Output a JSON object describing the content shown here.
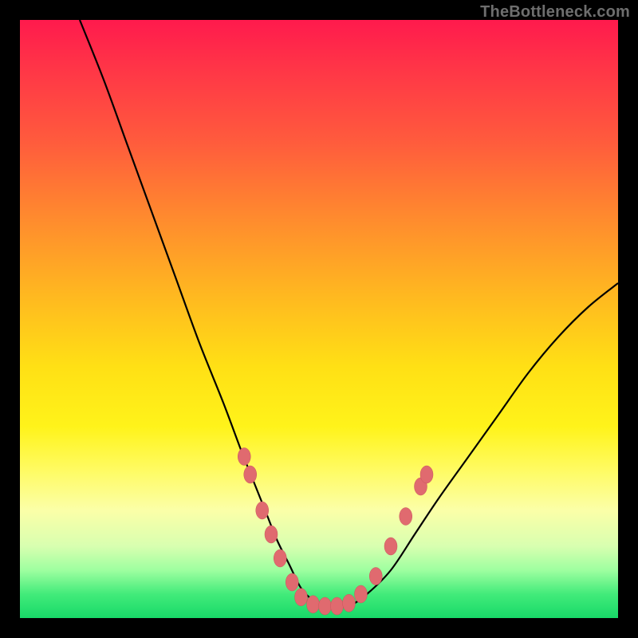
{
  "watermark": "TheBottleneck.com",
  "colors": {
    "curve_stroke": "#000000",
    "marker_fill": "#e06a6f",
    "marker_stroke": "#c9565c"
  },
  "chart_data": {
    "type": "line",
    "title": "",
    "xlabel": "",
    "ylabel": "",
    "xlim": [
      0,
      100
    ],
    "ylim": [
      0,
      100
    ],
    "series": [
      {
        "name": "bottleneck-curve",
        "x": [
          10,
          14,
          18,
          22,
          26,
          30,
          34,
          37,
          39,
          41,
          43,
          45,
          47,
          49,
          51,
          53,
          55,
          58,
          62,
          66,
          70,
          75,
          80,
          85,
          90,
          95,
          100
        ],
        "y": [
          100,
          90,
          79,
          68,
          57,
          46,
          36,
          28,
          23,
          18,
          13,
          9,
          5,
          3,
          2,
          2,
          2,
          4,
          8,
          14,
          20,
          27,
          34,
          41,
          47,
          52,
          56
        ]
      }
    ],
    "markers": {
      "name": "highlight-dots",
      "points": [
        {
          "x": 37.5,
          "y": 27
        },
        {
          "x": 38.5,
          "y": 24
        },
        {
          "x": 40.5,
          "y": 18
        },
        {
          "x": 42.0,
          "y": 14
        },
        {
          "x": 43.5,
          "y": 10
        },
        {
          "x": 45.5,
          "y": 6
        },
        {
          "x": 47.0,
          "y": 3.5
        },
        {
          "x": 49.0,
          "y": 2.3
        },
        {
          "x": 51.0,
          "y": 2.0
        },
        {
          "x": 53.0,
          "y": 2.0
        },
        {
          "x": 55.0,
          "y": 2.5
        },
        {
          "x": 57.0,
          "y": 4
        },
        {
          "x": 59.5,
          "y": 7
        },
        {
          "x": 62.0,
          "y": 12
        },
        {
          "x": 64.5,
          "y": 17
        },
        {
          "x": 67.0,
          "y": 22
        },
        {
          "x": 68.0,
          "y": 24
        }
      ]
    }
  }
}
